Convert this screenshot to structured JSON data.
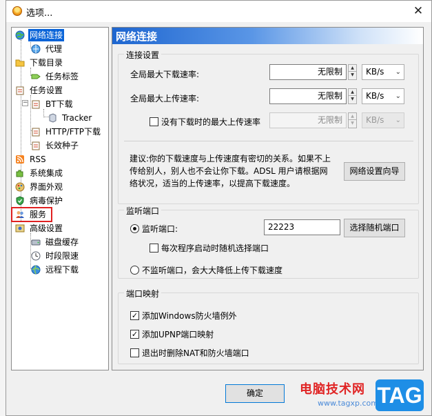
{
  "window": {
    "title": "选项...",
    "close_glyph": "✕"
  },
  "tree": {
    "items": [
      {
        "label": "网络连接",
        "icon": "globe-network-icon",
        "selected": true
      },
      {
        "label": "代理",
        "icon": "proxy-globe-icon"
      },
      {
        "label": "下载目录",
        "icon": "folder-icon"
      },
      {
        "label": "任务标签",
        "icon": "tag-icon"
      },
      {
        "label": "任务设置",
        "icon": "clipboard-icon"
      },
      {
        "label": "BT下载",
        "icon": "clipboard-icon"
      },
      {
        "label": "Tracker",
        "icon": "server-icon"
      },
      {
        "label": "HTTP/FTP下载",
        "icon": "clipboard-icon"
      },
      {
        "label": "长效种子",
        "icon": "clipboard-icon"
      },
      {
        "label": "RSS",
        "icon": "rss-icon"
      },
      {
        "label": "系统集成",
        "icon": "puzzle-icon"
      },
      {
        "label": "界面外观",
        "icon": "palette-icon"
      },
      {
        "label": "病毒保护",
        "icon": "shield-icon"
      },
      {
        "label": "服务",
        "icon": "users-icon",
        "highlighted": true
      },
      {
        "label": "高级设置",
        "icon": "advanced-settings-icon"
      },
      {
        "label": "磁盘缓存",
        "icon": "disk-icon"
      },
      {
        "label": "时段限速",
        "icon": "clock-icon"
      },
      {
        "label": "远程下载",
        "icon": "remote-globe-icon"
      }
    ]
  },
  "panel": {
    "title": "网络连接",
    "connection": {
      "group_title": "连接设置",
      "max_download_label": "全局最大下载速率:",
      "max_download_value": "无限制",
      "max_download_unit": "KB/s",
      "max_upload_label": "全局最大上传速率:",
      "max_upload_value": "无限制",
      "max_upload_unit": "KB/s",
      "idle_upload_label": "没有下载时的最大上传速率",
      "idle_upload_checked": false,
      "idle_upload_value": "无限制",
      "idle_upload_unit": "KB/s",
      "advice_line1": "建议:你的下载速度与上传速度有密切的关系。如果不上",
      "advice_line2": "传给别人，别人也不会让你下载。ADSL 用户请根据网",
      "advice_line3": "络状况，适当的上传速率，以提高下载速度。",
      "wizard_button": "网络设置向导"
    },
    "listen": {
      "group_title": "监听端口",
      "listen_label": "监听端口:",
      "port_value": "22223",
      "random_button": "选择随机端口",
      "random_each_start_label": "每次程序启动时随机选择端口",
      "no_listen_label": "不监听端口，会大大降低上传下载速度"
    },
    "mapping": {
      "group_title": "端口映射",
      "firewall_label": "添加Windows防火墙例外",
      "firewall_checked": true,
      "upnp_label": "添加UPNP端口映射",
      "upnp_checked": true,
      "remove_nat_label": "退出时删除NAT和防火墙端口",
      "remove_nat_checked": false,
      "check_glyph": "✓"
    }
  },
  "footer": {
    "ok_button": "确定"
  },
  "watermark": {
    "text": "电脑技术网",
    "url": "www.tagxp.com",
    "tag": "TAG"
  },
  "colors": {
    "selection": "#0a64d8",
    "header_gradient_start": "#1e66d0",
    "highlight_box": "#e02020"
  }
}
